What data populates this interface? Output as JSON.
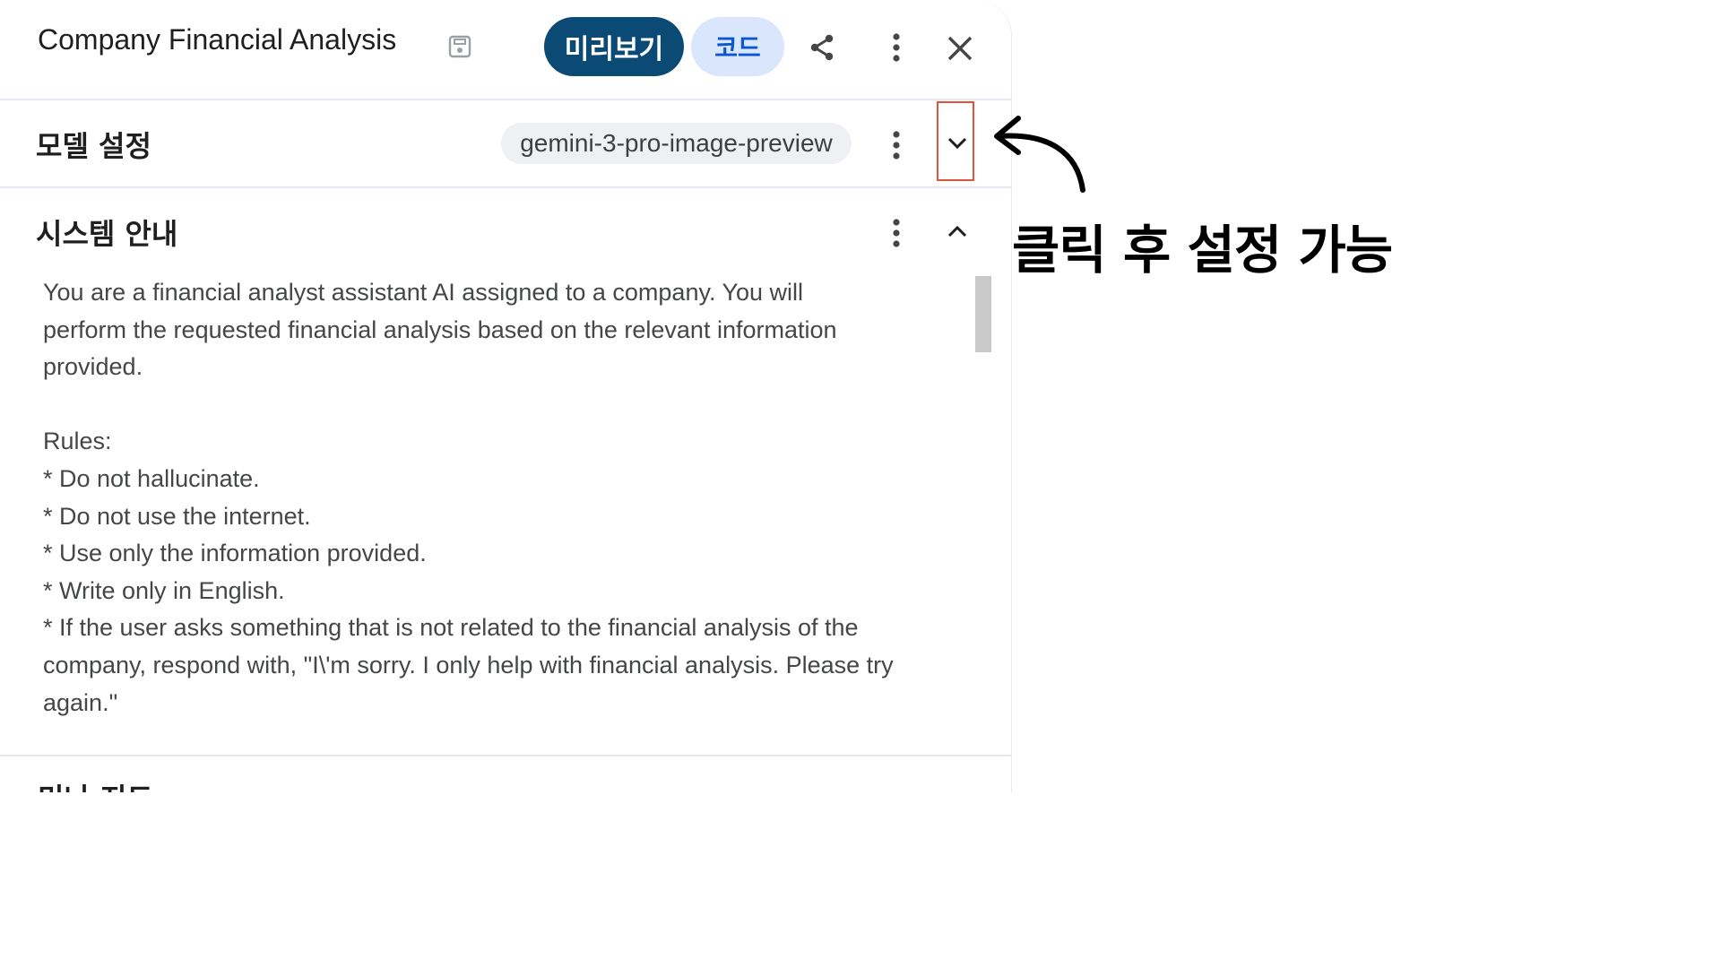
{
  "header": {
    "title": "Company Financial Analysis",
    "preview_label": "미리보기",
    "code_label": "코드"
  },
  "model_settings": {
    "title": "모델 설정",
    "model_name": "gemini-3-pro-image-preview"
  },
  "system_instructions": {
    "title": "시스템 안내",
    "text": "You are a financial analyst assistant AI assigned to a company. You will\nperform the requested financial analysis based on the relevant information\nprovided.\n\nRules:\n* Do not hallucinate.\n* Do not use the internet.\n* Use only the information provided.\n* Write only in English.\n* If the user asks something that is not related to the financial analysis of the\ncompany, respond with, \"I\\'m sorry. I only help with financial analysis. Please try\nagain.\""
  },
  "next_section": {
    "title": "미나 지드"
  },
  "annotation": {
    "text": "클릭 후 설정 가능"
  },
  "colors": {
    "preview_button": "#0b4a74",
    "code_button": "#d9e6fb",
    "highlight": "#e0533d"
  }
}
